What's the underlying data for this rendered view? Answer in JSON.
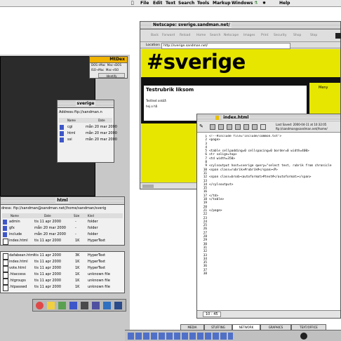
{
  "menubar": {
    "items": [
      "File",
      "Edit",
      "Text",
      "Search",
      "Tools",
      "Markup",
      "Windows",
      "Help"
    ]
  },
  "browser": {
    "title": "Netscape: sverige.sandman.net/",
    "toolbar": [
      "Back",
      "Forward",
      "Reload",
      "Home",
      "Search",
      "Netscape",
      "Images",
      "Print",
      "Security",
      "Shop",
      "Stop"
    ],
    "location_label": "Location:",
    "location_value": "http://sverige.sandman.net/",
    "logo_text": "#sverige",
    "side_link": "Meny",
    "content_heading": "Testrubrik liksom",
    "content_lines": [
      "Testtext osköå",
      "hej o hå"
    ]
  },
  "editor": {
    "title": "index.html",
    "saved_label": "Last Saved: 2000-04-11 at 10:32:05",
    "path_label": "ftp://sandman@sandman.net//home/",
    "line_numbers": [
      "1",
      "2",
      "3",
      "4",
      "5",
      "6",
      "7",
      "8",
      "9",
      "10",
      "11",
      "12",
      "13",
      "14",
      "15",
      "16",
      "17",
      "18",
      "19",
      "20",
      "21",
      "22",
      "23",
      "24",
      "25",
      "26",
      "27",
      "28",
      "29",
      "30",
      "31",
      "32",
      "33",
      "34",
      "35",
      "36",
      "37",
      "38"
    ],
    "code_lines": [
      "<!--#include file=\"include/common.txt\">",
      "<page>",
      "",
      "",
      "<table cellpadding=0 cellspacing=0 border=0 width=400>",
      "<tr valign=top>",
      "<td width=350>",
      "",
      "<cylsoutput host=sverige query=\"select text, rubrik from chronicle",
      "<span class=rubrik>#rubrik#</span><P>",
      "",
      "<span class=brod><autoformat>#text#</autoformat></span>",
      "",
      "</cylsoutput>",
      "",
      "",
      "</td>",
      "</table>",
      "",
      "",
      "</page>"
    ],
    "status_pos": "10 : 45"
  },
  "dos_panel": {
    "title": "MtDex",
    "rows": [
      "DOS→Mac  Mac→DOS",
      "ISO→Mac  Mac→ISO",
      "Identify"
    ]
  },
  "sverige_window": {
    "title": "sverige",
    "address_label": "Address:",
    "address_value": "ftp://sandman.n",
    "columns": [
      "Name",
      "Date"
    ],
    "files": [
      {
        "name": "cgi",
        "date": "mån 20 mar 2000"
      },
      {
        "name": "html",
        "date": "mån 20 mar 2000"
      },
      {
        "name": "ssi",
        "date": "mån 20 mar 2000"
      }
    ]
  },
  "html_window": {
    "title": "html",
    "address_label": "dress:",
    "address_value": "ftp://sandman@sandman.net//home/sandman/sverig",
    "columns": [
      "Name",
      "Date",
      "Size",
      "Kind"
    ],
    "files": [
      {
        "name": "admin",
        "date": "tis 11 apr 2000",
        "size": "-",
        "kind": "folder"
      },
      {
        "name": "gfx",
        "date": "mån 20 mar 2000",
        "size": "-",
        "kind": "folder"
      },
      {
        "name": "include",
        "date": "mån 20 mar 2000",
        "size": "-",
        "kind": "folder"
      },
      {
        "name": "index.html",
        "date": "tis 11 apr 2000",
        "size": "1K",
        "kind": "HyperText"
      }
    ]
  },
  "bottom_list": {
    "files": [
      {
        "name": "dafabean.html",
        "date": "tis 11 apr 2000",
        "size": "3K",
        "kind": "HyperText"
      },
      {
        "name": "index.html",
        "date": "tis 11 apr 2000",
        "size": "1K",
        "kind": "HyperText"
      },
      {
        "name": "vote.html",
        "date": "tis 11 apr 2000",
        "size": "1K",
        "kind": "HyperText"
      },
      {
        "name": ".htaccess",
        "date": "tis 11 apr 2000",
        "size": "1K",
        "kind": "unknown file"
      },
      {
        "name": ".htgroups",
        "date": "tis 11 apr 2000",
        "size": "1K",
        "kind": "unknown file"
      },
      {
        "name": ".htpasswd",
        "date": "tis 11 apr 2000",
        "size": "1K",
        "kind": "unknown file"
      }
    ]
  },
  "bottom_tabs": [
    "MEDIA",
    "STUFFING",
    "NETWORK",
    "GRAPHICS",
    "TEXT/OFFICE"
  ],
  "colors": {
    "yellow": "#e6e600",
    "desktop": "#c9c9c9",
    "dark": "#2d2d2d",
    "accent": "#3d56c8"
  }
}
